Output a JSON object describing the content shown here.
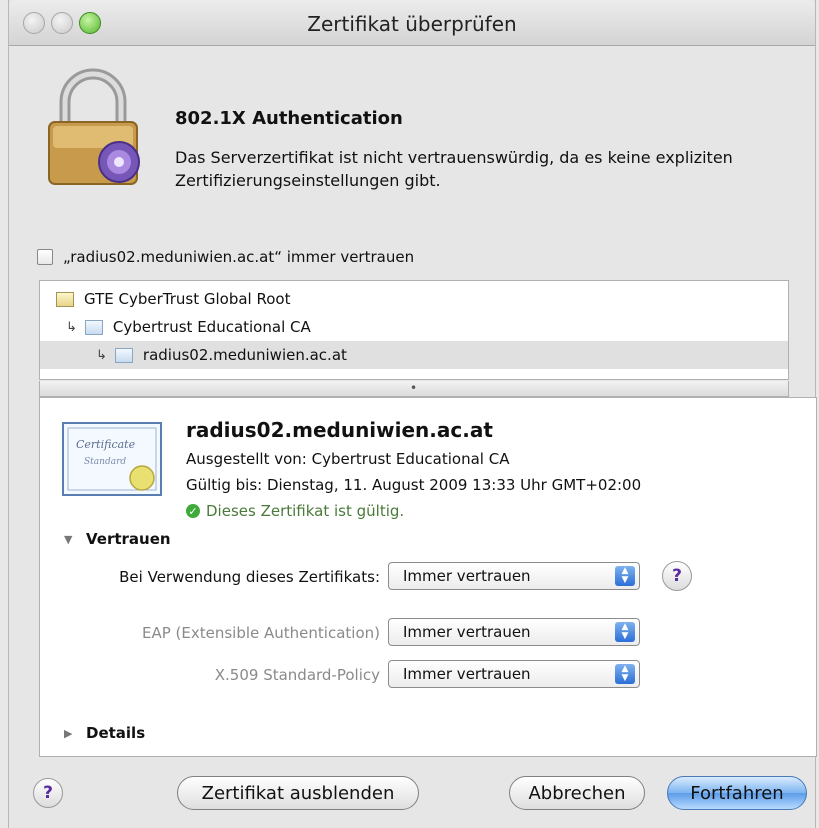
{
  "window": {
    "title": "Zertifikat überprüfen"
  },
  "header": {
    "heading": "802.1X Authentication",
    "message": "Das Serverzertifikat ist nicht vertrauenswürdig, da es keine expliziten Zertifizierungseinstellungen gibt."
  },
  "trust_checkbox": {
    "label": "„radius02.meduniwien.ac.at“ immer vertrauen",
    "checked": false
  },
  "tree": {
    "items": [
      {
        "label": "GTE CyberTrust Global Root",
        "selected": false
      },
      {
        "label": "Cybertrust Educational CA",
        "selected": false
      },
      {
        "label": "radius02.meduniwien.ac.at",
        "selected": true
      }
    ]
  },
  "detail": {
    "name": "radius02.meduniwien.ac.at",
    "issued_by": "Ausgestellt von: Cybertrust Educational CA",
    "valid_until": "Gültig bis: Dienstag, 11. August 2009 13:33 Uhr GMT+02:00",
    "status": "Dieses Zertifikat ist gültig.",
    "cert_icon_text": {
      "line1": "Certificate",
      "line2": "Standard"
    }
  },
  "trust_section": {
    "label": "Vertrauen",
    "expanded": true,
    "rows": [
      {
        "label": "Bei Verwendung dieses Zertifikats:",
        "value": "Immer vertrauen",
        "dim": false
      },
      {
        "label": "EAP (Extensible Authentication)",
        "value": "Immer vertrauen",
        "dim": true
      },
      {
        "label": "X.509 Standard-Policy",
        "value": "Immer vertrauen",
        "dim": true
      }
    ],
    "help": "?"
  },
  "details_section": {
    "label": "Details",
    "expanded": false
  },
  "buttons": {
    "help": "?",
    "hide_certificate": "Zertifikat ausblenden",
    "cancel": "Abbrechen",
    "continue": "Fortfahren"
  },
  "colors": {
    "valid": "#3faa3a",
    "primary_button": "#5c9ce8",
    "help_glyph": "#5a2aa0"
  }
}
